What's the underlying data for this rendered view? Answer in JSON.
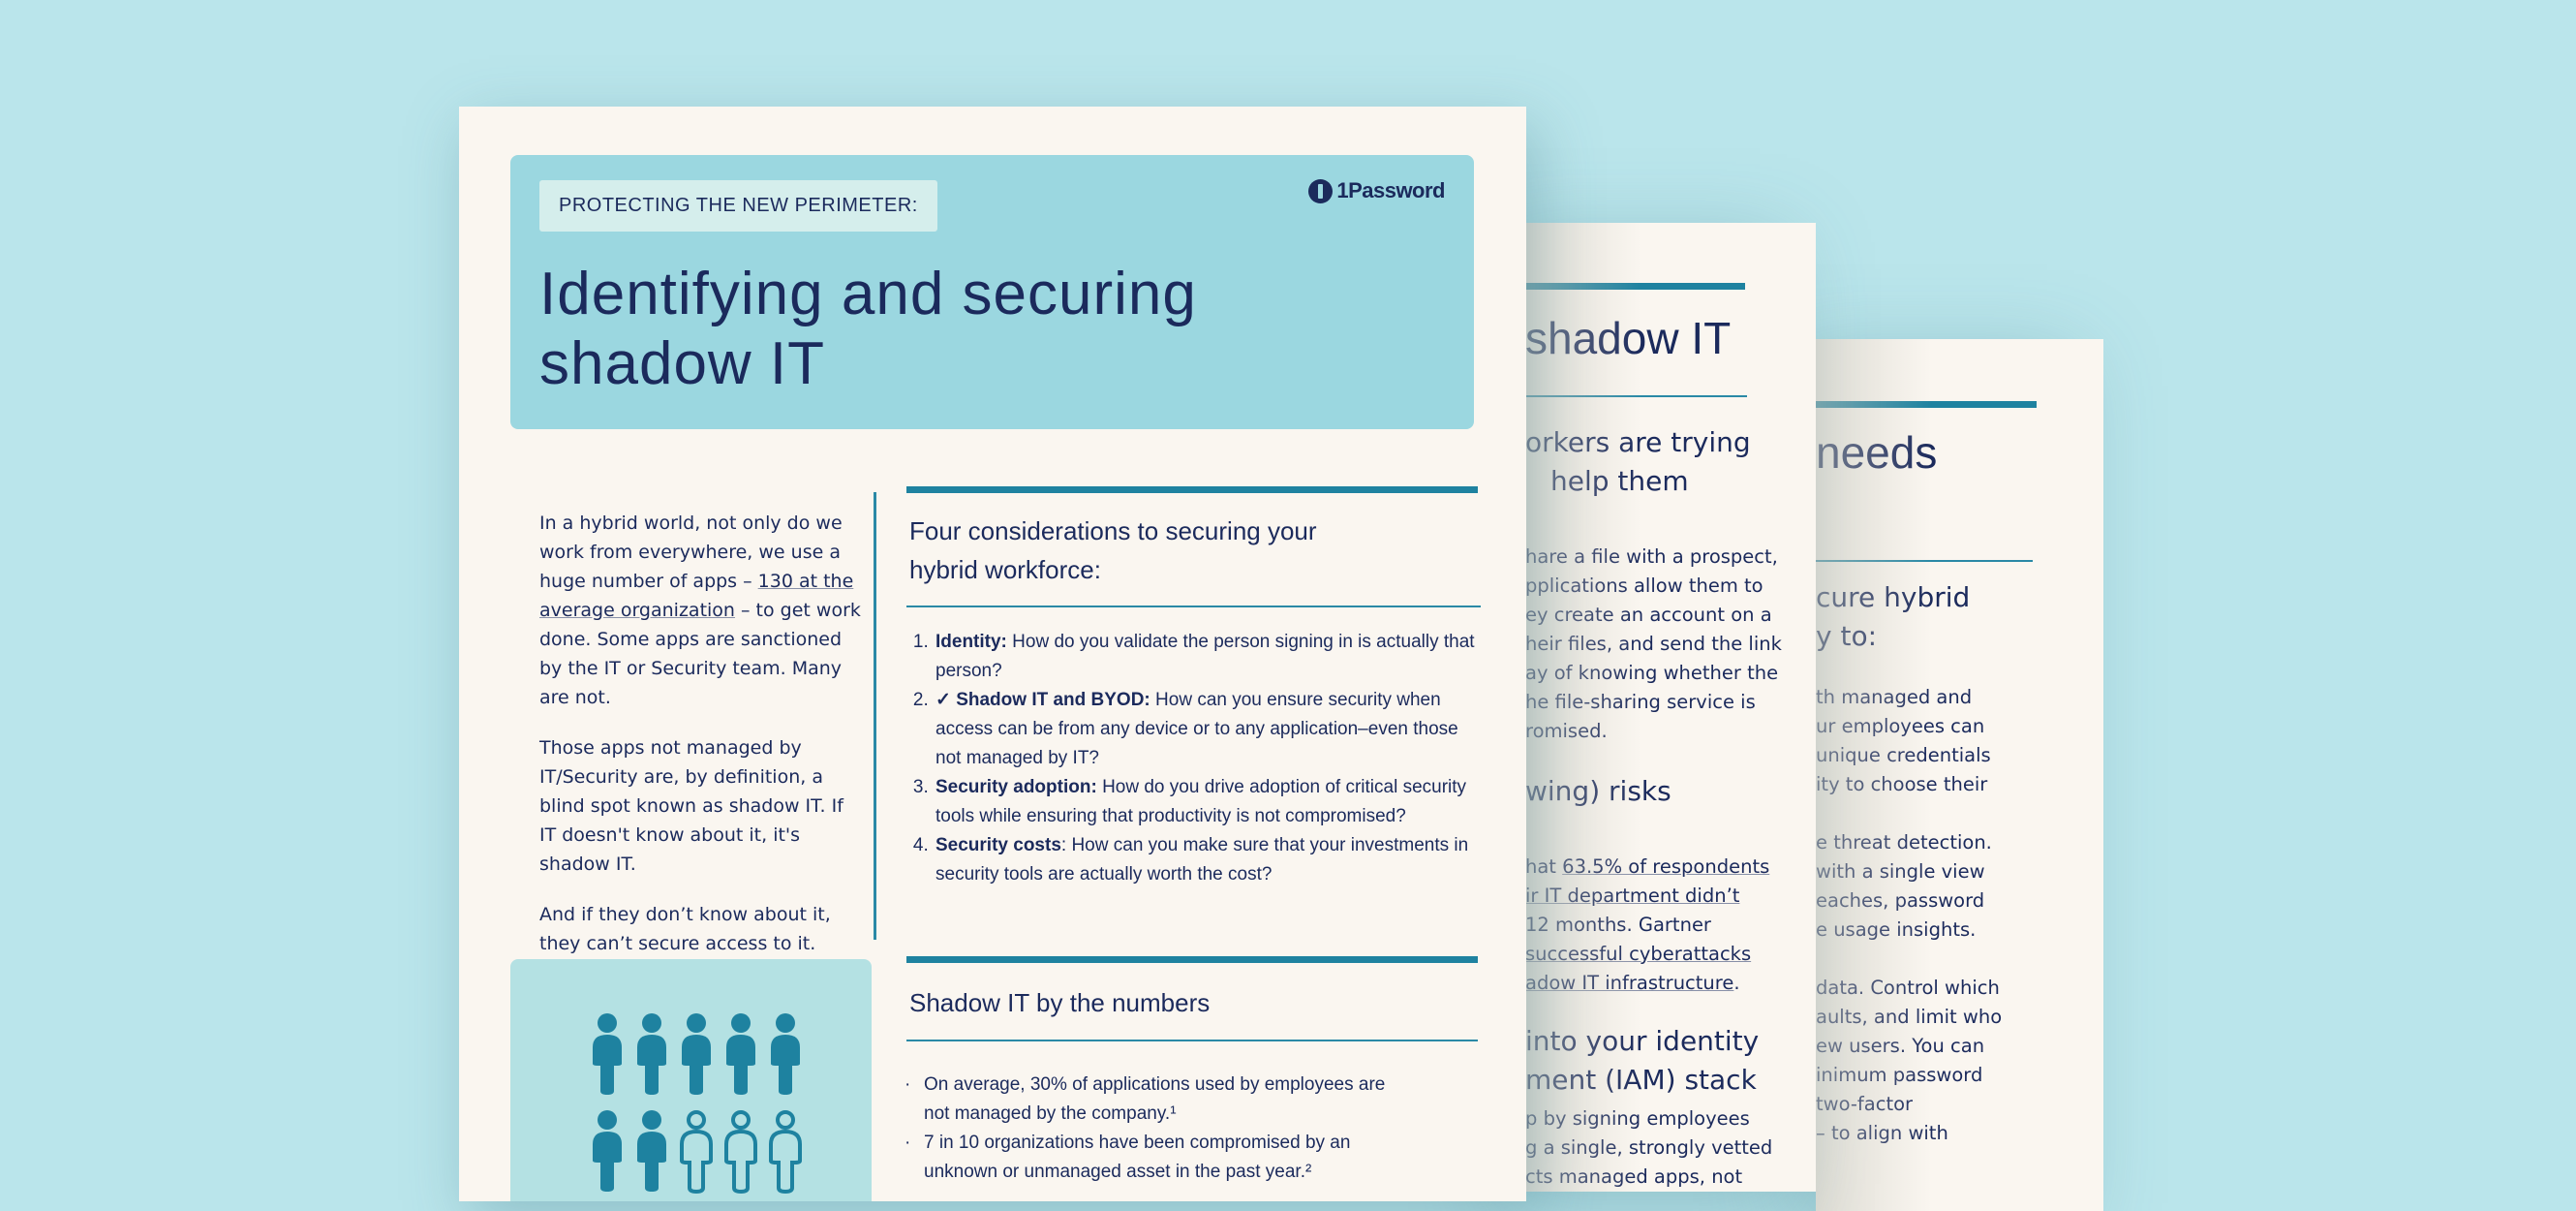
{
  "page3": {
    "heading_fragment": "needs",
    "subheading_lines": [
      "cure hybrid",
      "y to:"
    ],
    "body_lines": [
      "th managed and",
      "ur employees can",
      "unique credentials",
      "ity to choose their",
      "",
      "e threat detection.",
      "with a single view",
      "eaches, password",
      "e usage insights.",
      "",
      "data. Control which",
      "aults, and limit who",
      "ew users. You can",
      "inimum password",
      "two-factor",
      "– to align with"
    ]
  },
  "page2": {
    "heading_fragment": "shadow IT",
    "subheading_lines": [
      "orkers are trying",
      "help them"
    ],
    "body_lines_1": [
      "hare a file with a prospect,",
      "pplications allow them to",
      "ey create an account on a",
      "heir files, and send the link",
      "ay of knowing whether the",
      "he file-sharing service is",
      "romised."
    ],
    "section2_heading": "wing) risks",
    "body_lines_2": [
      {
        "pre": "hat ",
        "link": "63.5% of respondents",
        "post": ""
      },
      {
        "pre": "",
        "link": "ir IT department didn’t",
        "post": ""
      },
      {
        "pre": "12 months. Gartner",
        "link": "",
        "post": ""
      },
      {
        "pre": "",
        "link": "successful cyberattacks",
        "post": ""
      },
      {
        "pre": "",
        "link": "adow IT infrastructure",
        "post": "."
      }
    ],
    "section3_heading_lines": [
      "into your identity",
      "ment (IAM) stack"
    ],
    "body_lines_3": [
      "p by signing employees",
      "g a single, strongly vetted",
      "cts managed apps, not"
    ]
  },
  "page1": {
    "kicker": "PROTECTING THE NEW PERIMETER:",
    "brand": "1Password",
    "headline": "Identifying and securing shadow IT",
    "intro": {
      "p1_pre": "In a hybrid world, not only do we work from everywhere, we use a huge number of apps – ",
      "p1_link": "130 at the average organization",
      "p1_post": " – to get work done. Some apps are sanctioned by the IT or Security team. Many are not.",
      "p2": "Those apps not managed by IT/Security are, by definition, a blind spot known as shadow IT. If IT doesn't know about it, it's shadow IT.",
      "p3": "And if they don’t know about it, they can’t secure access to it."
    },
    "considerations": {
      "title": "Four considerations to securing your hybrid workforce:",
      "items": [
        {
          "label": "Identity:",
          "text": " How do you validate the person signing in is actually that person?"
        },
        {
          "label": "✓ Shadow IT and BYOD:",
          "text": " How can you ensure security when access can be from any device or to any application–even those not managed by IT?"
        },
        {
          "label": "Security adoption:",
          "text": " How do you drive adoption of critical security tools while ensuring that productivity is not compromised?"
        },
        {
          "label": "Security costs",
          "text": ": How can you make sure that your investments in security tools are actually worth the cost?"
        }
      ]
    },
    "numbers": {
      "title": "Shadow IT by the numbers",
      "items": [
        "On average, 30% of applications used by employees are not managed by the company.¹",
        "7 in 10 organizations have been compromised by an unknown or unmanaged asset in the past year.²"
      ],
      "pictogram": {
        "total": 10,
        "filled_visible_row2": 2,
        "outlined": 3
      }
    }
  }
}
